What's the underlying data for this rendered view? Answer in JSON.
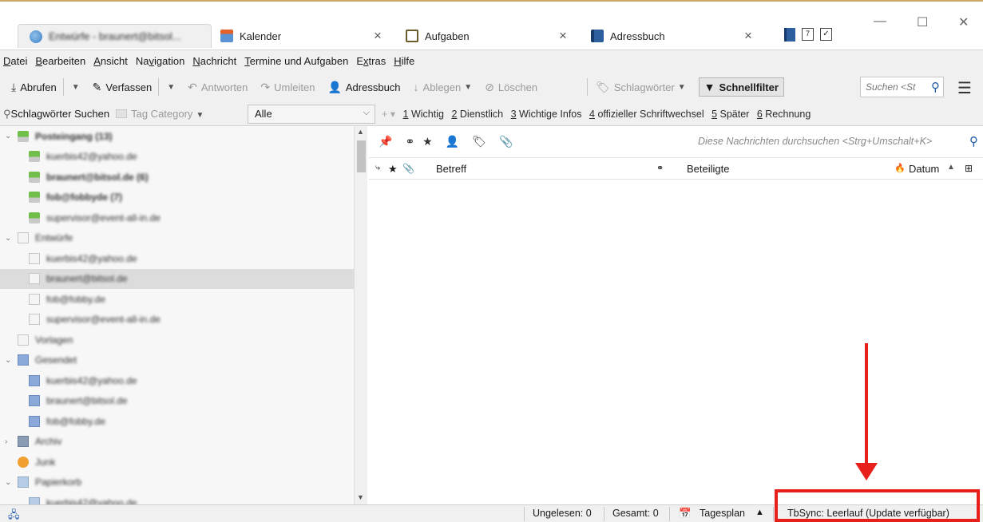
{
  "tabs": [
    {
      "label": "Entwürfe - braunert@bitsol...",
      "icon": "mail-tab-icon",
      "blurred": true
    },
    {
      "label": "Kalender",
      "icon": "calendar-tab-icon"
    },
    {
      "label": "Aufgaben",
      "icon": "tasks-tab-icon"
    },
    {
      "label": "Adressbuch",
      "icon": "addressbook-tab-icon"
    }
  ],
  "tab_close": "×",
  "window_controls": {
    "minimize": "—",
    "maximize": "☐",
    "close": "✕"
  },
  "menu": [
    {
      "label": "Datei",
      "accel": "D"
    },
    {
      "label": "Bearbeiten",
      "accel": "B"
    },
    {
      "label": "Ansicht",
      "accel": "A"
    },
    {
      "label": "Navigation",
      "accel": "v"
    },
    {
      "label": "Nachricht",
      "accel": "N"
    },
    {
      "label": "Termine und Aufgaben",
      "accel": "T"
    },
    {
      "label": "Extras",
      "accel": "x"
    },
    {
      "label": "Hilfe",
      "accel": "H"
    }
  ],
  "toolbar": {
    "abrufen": "Abrufen",
    "verfassen": "Verfassen",
    "antworten": "Antworten",
    "umleiten": "Umleiten",
    "adressbuch": "Adressbuch",
    "ablegen": "Ablegen",
    "loeschen": "Löschen",
    "schlagwoerter": "Schlagwörter",
    "schnellfilter": "Schnellfilter",
    "search_placeholder": "Suchen <St"
  },
  "quickfilter": {
    "schlagwoerter_suchen": "Schlagwörter Suchen",
    "tag_category": "Tag Category",
    "alle": "Alle",
    "tags": [
      {
        "num": "1",
        "label": "Wichtig"
      },
      {
        "num": "2",
        "label": "Dienstlich"
      },
      {
        "num": "3",
        "label": "Wichtige Infos"
      },
      {
        "num": "4",
        "label": "offizieller Schriftwechsel"
      },
      {
        "num": "5",
        "label": "Später"
      },
      {
        "num": "6",
        "label": "Rechnung"
      }
    ]
  },
  "folders": [
    {
      "label": "Posteingang (13)",
      "level": 0,
      "icon": "inbox-icon",
      "bold": true,
      "twisty": "⌄"
    },
    {
      "label": "kuerbis42@yahoo.de",
      "level": 1,
      "icon": "inbox-icon"
    },
    {
      "label": "braunert@bitsol.de (6)",
      "level": 1,
      "icon": "inbox-icon",
      "bold": true
    },
    {
      "label": "fob@fobbyde (7)",
      "level": 1,
      "icon": "inbox-icon",
      "bold": true
    },
    {
      "label": "supervisor@event-all-in.de",
      "level": 1,
      "icon": "inbox-icon"
    },
    {
      "label": "Entwürfe",
      "level": 0,
      "icon": "drafts-icon",
      "twisty": "⌄"
    },
    {
      "label": "kuerbis42@yahoo.de",
      "level": 1,
      "icon": "drafts-icon"
    },
    {
      "label": "braunert@bitsol.de",
      "level": 1,
      "icon": "drafts-icon",
      "selected": true
    },
    {
      "label": "fob@fobby.de",
      "level": 1,
      "icon": "drafts-icon"
    },
    {
      "label": "supervisor@event-all-in.de",
      "level": 1,
      "icon": "drafts-icon"
    },
    {
      "label": "Vorlagen",
      "level": 0,
      "icon": "templates-icon"
    },
    {
      "label": "Gesendet",
      "level": 0,
      "icon": "sent-icon",
      "twisty": "⌄"
    },
    {
      "label": "kuerbis42@yahoo.de",
      "level": 1,
      "icon": "sent-icon"
    },
    {
      "label": "braunert@bitsol.de",
      "level": 1,
      "icon": "sent-icon"
    },
    {
      "label": "fob@fobby.de",
      "level": 1,
      "icon": "sent-icon"
    },
    {
      "label": "Archiv",
      "level": 0,
      "icon": "archive-icon",
      "twisty": "›"
    },
    {
      "label": "Junk",
      "level": 0,
      "icon": "junk-icon"
    },
    {
      "label": "Papierkorb",
      "level": 0,
      "icon": "trash-icon",
      "twisty": "⌄"
    },
    {
      "label": "kuerbis42@yahoo.de",
      "level": 1,
      "icon": "trash-icon"
    }
  ],
  "message_search_placeholder": "Diese Nachrichten durchsuchen <Strg+Umschalt+K>",
  "columns": {
    "betreff": "Betreff",
    "beteiligte": "Beteiligte",
    "datum": "Datum"
  },
  "status": {
    "ungelesen": "Ungelesen: 0",
    "gesamt": "Gesamt: 0",
    "tagesplan": "Tagesplan",
    "tbsync": "TbSync: Leerlauf (Update verfügbar)"
  },
  "colors": {
    "annotation": "#e8201c",
    "accent": "#1e5aa8",
    "chrome": "#f0f0f0"
  }
}
